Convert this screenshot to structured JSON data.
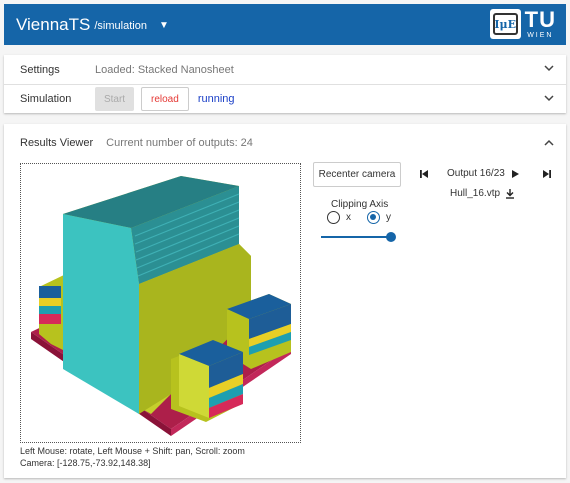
{
  "app": {
    "title": "ViennaTS",
    "route": "/simulation"
  },
  "logos": {
    "ipe_text": "IμE",
    "tu_text": "TU",
    "tu_sub": "WIEN"
  },
  "settings": {
    "label": "Settings",
    "value": "Loaded: Stacked Nanosheet"
  },
  "simulation": {
    "label": "Simulation",
    "start_label": "Start",
    "reload_label": "reload",
    "status": "running"
  },
  "results": {
    "title": "Results Viewer",
    "count_text": "Current number of outputs: 24",
    "recenter_label": "Recenter camera",
    "clipping_label": "Clipping Axis",
    "axis_x": "x",
    "axis_y": "y",
    "selected_axis": "y",
    "clip_slider_value": 1.0,
    "output_text": "Output 16/23",
    "file_name": "Hull_16.vtp",
    "help_text": "Left Mouse: rotate, Left Mouse + Shift: pan, Scroll: zoom",
    "camera_text": "Camera: [-128.75,-73.92,148.38]"
  },
  "colors": {
    "header": "#1565a8",
    "status": "#1a3fc7",
    "reload": "#e53935"
  }
}
